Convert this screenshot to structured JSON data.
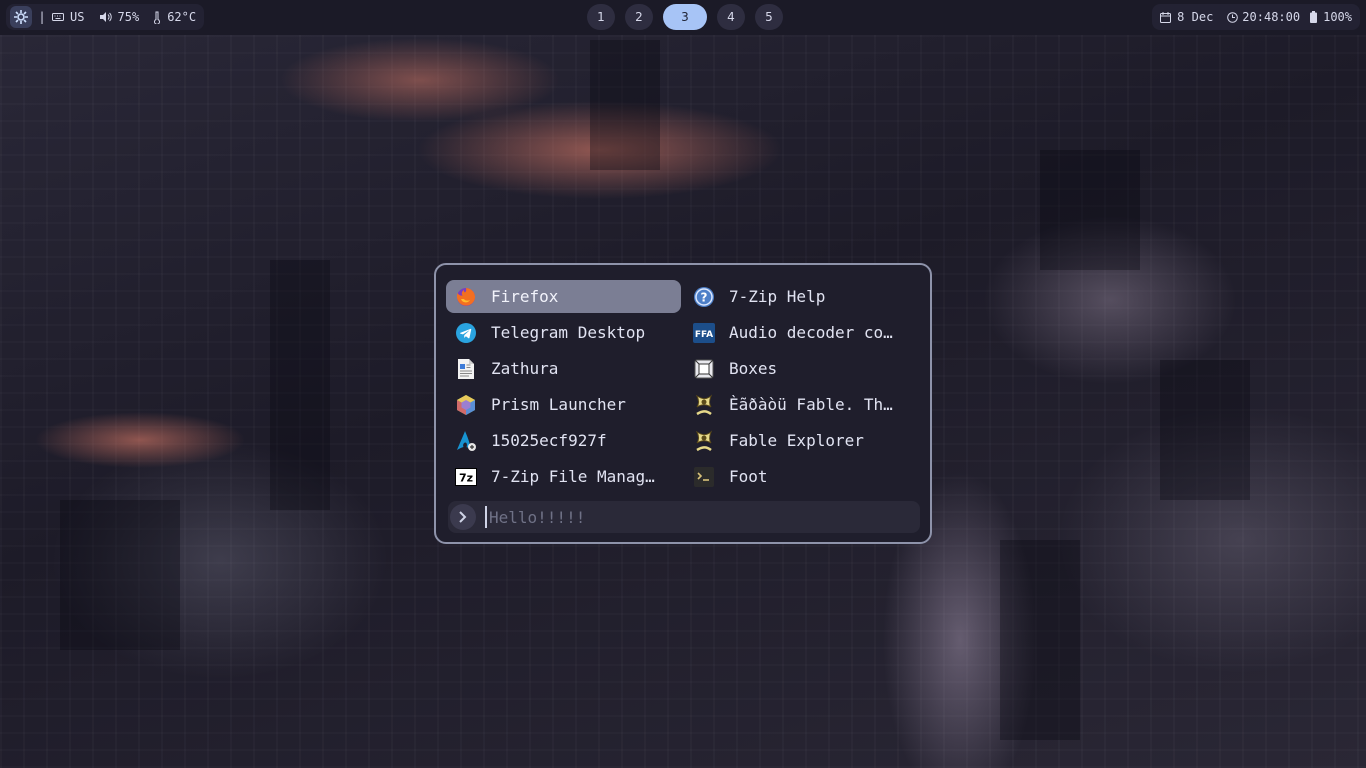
{
  "topbar": {
    "separator": "|",
    "keyboard_layout": "US",
    "volume": "75%",
    "temperature": "62°C",
    "workspaces": [
      "1",
      "2",
      "3",
      "4",
      "5"
    ],
    "active_workspace": "3",
    "date": "8 Dec",
    "time": "20:48:00",
    "battery": "100%"
  },
  "launcher": {
    "apps": [
      {
        "label": "Firefox",
        "icon": "firefox-icon",
        "selected": true
      },
      {
        "label": "7-Zip Help",
        "icon": "help-icon"
      },
      {
        "label": "Telegram Desktop",
        "icon": "telegram-icon"
      },
      {
        "label": "Audio decoder co…",
        "icon": "ffa-icon"
      },
      {
        "label": "Zathura",
        "icon": "document-icon"
      },
      {
        "label": "Boxes",
        "icon": "boxes-icon"
      },
      {
        "label": "Prism Launcher",
        "icon": "prism-icon"
      },
      {
        "label": "Èãðàòü Fable. Th…",
        "icon": "fable-icon"
      },
      {
        "label": "15025ecf927f",
        "icon": "arch-icon"
      },
      {
        "label": "Fable Explorer",
        "icon": "fable-icon"
      },
      {
        "label": "7-Zip File Manag…",
        "icon": "7zip-icon"
      },
      {
        "label": "Foot",
        "icon": "terminal-icon"
      }
    ],
    "search": {
      "placeholder": "Hello!!!!!",
      "value": ""
    }
  },
  "colors": {
    "accent_workspace": "#a7c4f6",
    "selected_item": "#7b7e94",
    "launcher_border": "#8e93aa",
    "bar_background": "#1b1a27"
  }
}
